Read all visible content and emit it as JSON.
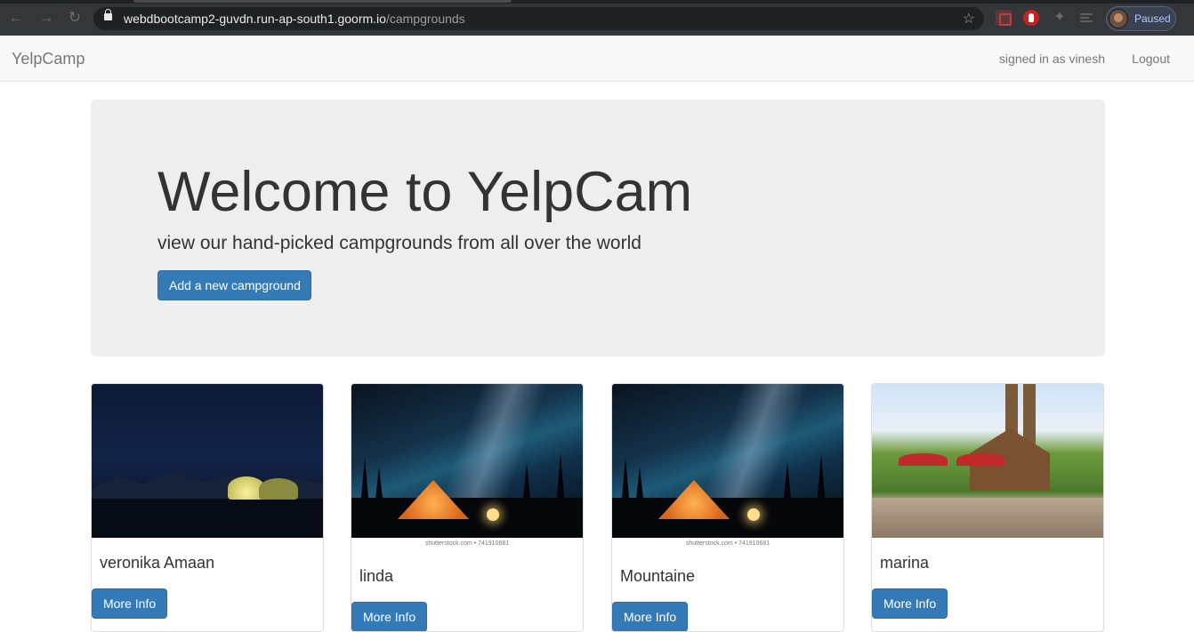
{
  "browser": {
    "url_host": "webdbootcamp2-guvdn.run-ap-south1.goorm.io",
    "url_path": "/campgrounds",
    "profile_label": "Paused"
  },
  "navbar": {
    "brand": "YelpCamp",
    "signed_in": "signed in as vinesh",
    "logout": "Logout"
  },
  "jumbotron": {
    "title": "Welcome to YelpCam",
    "subtitle": "view our hand-picked campgrounds from all over the world",
    "add_button": "Add a new campground"
  },
  "watermark": "shutterstock.com • 741910681",
  "campgrounds": [
    {
      "name": "veronika Amaan",
      "button": "More Info"
    },
    {
      "name": "linda",
      "button": "More Info"
    },
    {
      "name": "Mountaine",
      "button": "More Info"
    },
    {
      "name": "marina",
      "button": "More Info"
    }
  ]
}
